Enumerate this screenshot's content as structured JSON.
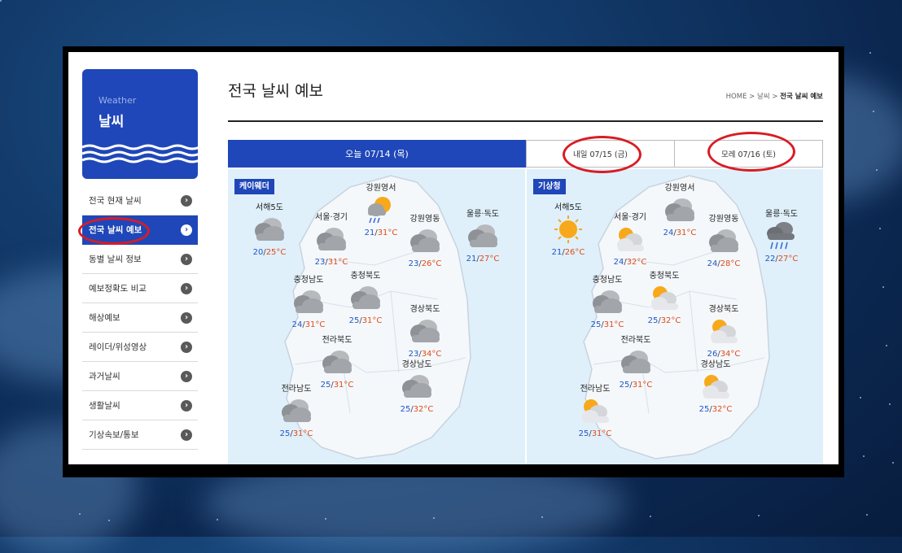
{
  "sidebar": {
    "brand_en": "Weather",
    "brand_ko": "날씨",
    "items": [
      {
        "label": "전국 현재 날씨",
        "active": false
      },
      {
        "label": "전국 날씨 예보",
        "active": true
      },
      {
        "label": "동별 날씨 정보",
        "active": false
      },
      {
        "label": "예보정확도 비교",
        "active": false
      },
      {
        "label": "해상예보",
        "active": false
      },
      {
        "label": "레이더/위성영상",
        "active": false
      },
      {
        "label": "과거날씨",
        "active": false
      },
      {
        "label": "생활날씨",
        "active": false
      },
      {
        "label": "기상속보/통보",
        "active": false
      }
    ]
  },
  "header": {
    "title": "전국 날씨 예보",
    "breadcrumb_home": "HOME",
    "breadcrumb_mid": "날씨",
    "breadcrumb_current": "전국 날씨 예보",
    "breadcrumb_sep": ">"
  },
  "tabs": [
    {
      "label": "오늘 07/14 (목)",
      "active": true
    },
    {
      "label": "내일 07/15 (금)",
      "active": false
    },
    {
      "label": "모레 07/16 (토)",
      "active": false
    }
  ],
  "panels": [
    {
      "tag": "케이웨더",
      "cities": [
        {
          "name": "서해5도",
          "icon": "cloudy-icon",
          "min": "20",
          "max": "25°C"
        },
        {
          "name": "서울·경기",
          "icon": "cloudy-icon",
          "min": "23",
          "max": "31°C"
        },
        {
          "name": "강원영서",
          "icon": "sun-rain-icon",
          "min": "21",
          "max": "31°C"
        },
        {
          "name": "강원영동",
          "icon": "cloudy-icon",
          "min": "23",
          "max": "26°C"
        },
        {
          "name": "울릉·독도",
          "icon": "cloudy-icon",
          "min": "21",
          "max": "27°C"
        },
        {
          "name": "충청남도",
          "icon": "cloudy-icon",
          "min": "24",
          "max": "31°C"
        },
        {
          "name": "충청북도",
          "icon": "cloudy-icon",
          "min": "25",
          "max": "31°C"
        },
        {
          "name": "경상북도",
          "icon": "cloudy-icon",
          "min": "23",
          "max": "34°C"
        },
        {
          "name": "전라북도",
          "icon": "cloudy-icon",
          "min": "25",
          "max": "31°C"
        },
        {
          "name": "경상남도",
          "icon": "cloudy-icon",
          "min": "25",
          "max": "32°C"
        },
        {
          "name": "전라남도",
          "icon": "cloudy-icon",
          "min": "25",
          "max": "31°C"
        }
      ]
    },
    {
      "tag": "기상청",
      "cities": [
        {
          "name": "서해5도",
          "icon": "sun-icon",
          "min": "21",
          "max": "26°C"
        },
        {
          "name": "서울·경기",
          "icon": "partly-cloudy-icon",
          "min": "24",
          "max": "32°C"
        },
        {
          "name": "강원영서",
          "icon": "cloudy-icon",
          "min": "24",
          "max": "31°C"
        },
        {
          "name": "강원영동",
          "icon": "cloudy-icon",
          "min": "24",
          "max": "28°C"
        },
        {
          "name": "울릉·독도",
          "icon": "rain-icon",
          "min": "22",
          "max": "27°C"
        },
        {
          "name": "충청남도",
          "icon": "cloudy-icon",
          "min": "25",
          "max": "31°C"
        },
        {
          "name": "충청북도",
          "icon": "partly-cloudy-icon",
          "min": "25",
          "max": "32°C"
        },
        {
          "name": "경상북도",
          "icon": "partly-cloudy-icon",
          "min": "26",
          "max": "34°C"
        },
        {
          "name": "전라북도",
          "icon": "cloudy-icon",
          "min": "25",
          "max": "31°C"
        },
        {
          "name": "경상남도",
          "icon": "partly-cloudy-icon",
          "min": "25",
          "max": "32°C"
        },
        {
          "name": "전라남도",
          "icon": "partly-cloudy-icon",
          "min": "25",
          "max": "31°C"
        }
      ]
    }
  ],
  "temp_separator": "/",
  "colors": {
    "brand_blue": "#1f47b9",
    "temp_min": "#1f55c9",
    "temp_max": "#e04a1a",
    "highlight_ring": "#d81c24",
    "map_bg": "#dff0fb"
  }
}
